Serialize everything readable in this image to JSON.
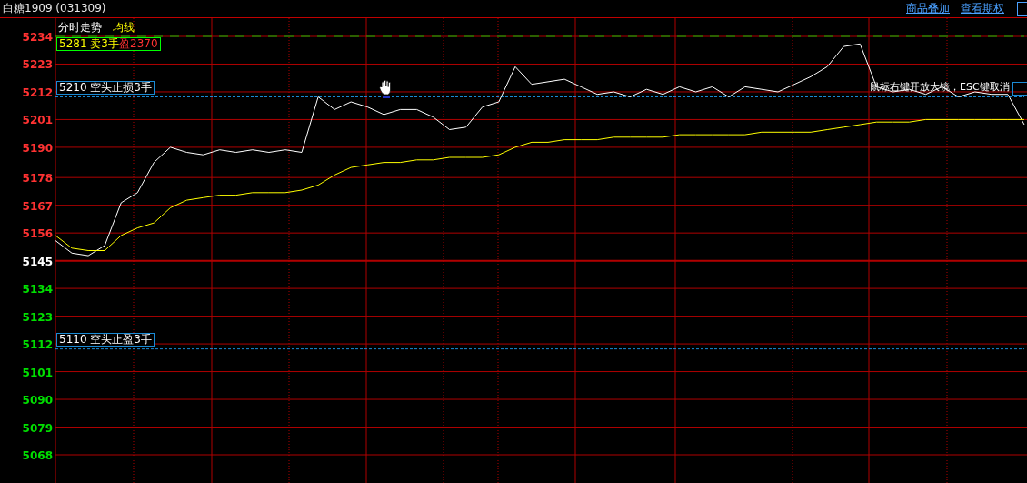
{
  "window": {
    "title": "白糖1909 (031309)"
  },
  "header_links": [
    {
      "label": "商品叠加"
    },
    {
      "label": "查看期权"
    }
  ],
  "hint": "鼠标右键开放大镜，ESC键取消",
  "orders": [
    {
      "kind": "target",
      "label": "5281 卖3手",
      "profit": "盈2370",
      "color": "#00ff00"
    },
    {
      "kind": "stop",
      "label": "5210 空头止损3手",
      "color": "#1a8ad4"
    },
    {
      "kind": "stop",
      "label": "5110 空头止盈3手",
      "color": "#1a8ad4"
    }
  ],
  "chart_data": {
    "type": "line",
    "ylim": [
      5068,
      5234
    ],
    "grid": true,
    "yticks": [
      5234,
      5223,
      5212,
      5201,
      5190,
      5178,
      5167,
      5156,
      5145,
      5134,
      5123,
      5112,
      5101,
      5090,
      5079,
      5068
    ],
    "series": [
      {
        "name": "分时走势",
        "color": "#ffffff",
        "values": [
          5153,
          5148,
          5147,
          5151,
          5168,
          5172,
          5184,
          5190,
          5188,
          5187,
          5189,
          5188,
          5189,
          5188,
          5189,
          5188,
          5210,
          5205,
          5208,
          5206,
          5203,
          5205,
          5205,
          5202,
          5197,
          5198,
          5206,
          5208,
          5222,
          5215,
          5216,
          5217,
          5214,
          5211,
          5212,
          5210,
          5213,
          5211,
          5214,
          5212,
          5214,
          5210,
          5214,
          5213,
          5212,
          5215,
          5218,
          5222,
          5230,
          5231,
          5214,
          5212,
          5213,
          5211,
          5214,
          5210,
          5212,
          5211,
          5211,
          5199
        ]
      },
      {
        "name": "均线",
        "color": "#ffff00",
        "values": [
          5155,
          5150,
          5149,
          5149,
          5155,
          5158,
          5160,
          5166,
          5169,
          5170,
          5171,
          5171,
          5172,
          5172,
          5172,
          5173,
          5175,
          5179,
          5182,
          5183,
          5184,
          5184,
          5185,
          5185,
          5186,
          5186,
          5186,
          5187,
          5190,
          5192,
          5192,
          5193,
          5193,
          5193,
          5194,
          5194,
          5194,
          5194,
          5195,
          5195,
          5195,
          5195,
          5195,
          5196,
          5196,
          5196,
          5196,
          5197,
          5198,
          5199,
          5200,
          5200,
          5200,
          5201,
          5201,
          5201,
          5201,
          5201,
          5201,
          5201
        ]
      }
    ],
    "ref_lines": [
      {
        "axis": "y",
        "value": 5145,
        "color": "#b00000"
      },
      {
        "axis": "y",
        "value": 5234,
        "color": "#00c000"
      },
      {
        "axis": "y",
        "value": 5210,
        "color": "#1a8ad4"
      },
      {
        "axis": "y",
        "value": 5110,
        "color": "#1a8ad4"
      }
    ]
  }
}
